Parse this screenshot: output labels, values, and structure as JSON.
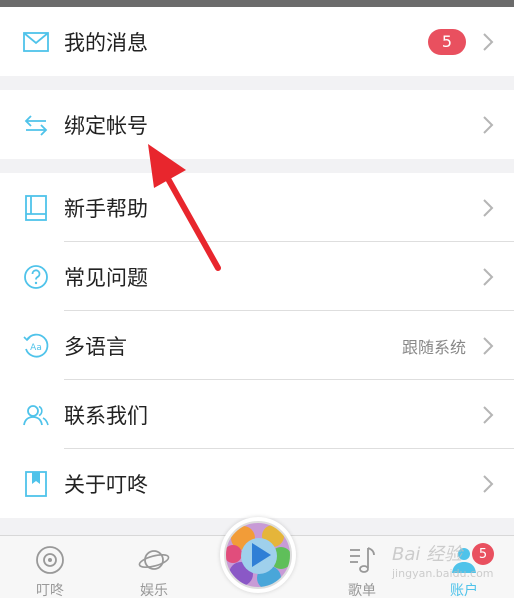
{
  "menu": {
    "group1": [
      {
        "id": "messages",
        "label": "我的消息",
        "icon": "mail-icon",
        "badge": "5"
      }
    ],
    "group2": [
      {
        "id": "bind-account",
        "label": "绑定帐号",
        "icon": "swap-arrows-icon"
      }
    ],
    "group3": [
      {
        "id": "help",
        "label": "新手帮助",
        "icon": "book-icon"
      },
      {
        "id": "faq",
        "label": "常见问题",
        "icon": "question-icon"
      },
      {
        "id": "language",
        "label": "多语言",
        "icon": "language-icon",
        "value": "跟随系统"
      },
      {
        "id": "contact",
        "label": "联系我们",
        "icon": "contacts-icon"
      },
      {
        "id": "about",
        "label": "关于叮咚",
        "icon": "bookmark-icon"
      }
    ]
  },
  "tabbar": {
    "tabs": [
      {
        "id": "dingdong",
        "label": "叮咚",
        "icon": "target-icon"
      },
      {
        "id": "entertainment",
        "label": "娱乐",
        "icon": "planet-icon"
      },
      {
        "id": "playlist",
        "label": "歌单",
        "icon": "music-note-icon"
      },
      {
        "id": "account",
        "label": "账户",
        "icon": "user-icon",
        "badge": "5",
        "active": true
      }
    ]
  },
  "colors": {
    "accent": "#4fc3ea",
    "badge": "#e9505f",
    "arrow": "#e8262d"
  },
  "watermark": {
    "main": "Bai 经验",
    "sub": "jingyan.baidu.com"
  }
}
